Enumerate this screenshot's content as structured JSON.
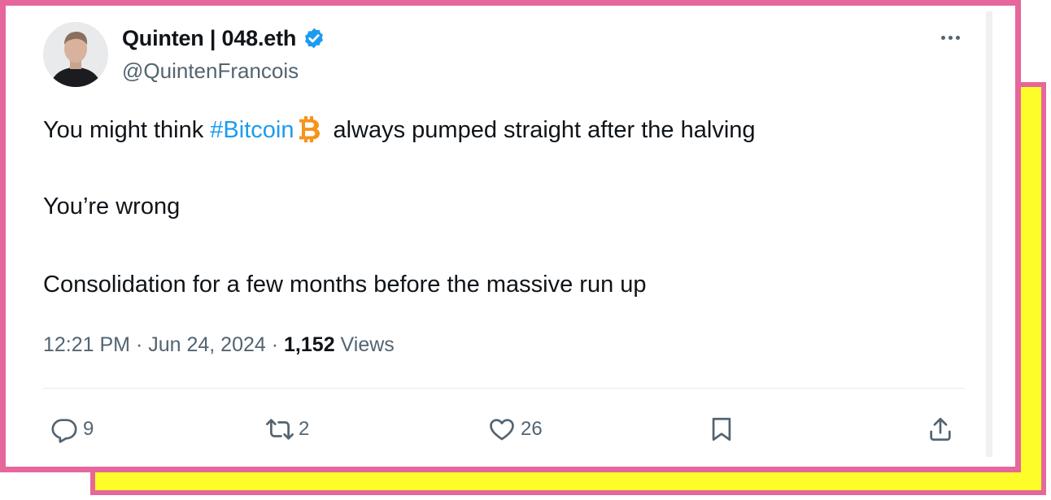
{
  "author": {
    "display_name": "Quinten | 048.eth",
    "handle": "@QuintenFrancois",
    "verified": true
  },
  "tweet": {
    "line1_before": "You might think ",
    "hashtag": "#Bitcoin",
    "line1_emoji": "bitcoin-icon",
    "line1_after": "always pumped straight after the halving",
    "line2": "You’re wrong",
    "line3": "Consolidation for a few months before the massive run up"
  },
  "meta": {
    "time": "12:21 PM",
    "separator": " · ",
    "date": "Jun 24, 2024",
    "views_count": "1,152",
    "views_label": "Views"
  },
  "actions": {
    "reply_count": "9",
    "retweet_count": "2",
    "like_count": "26"
  },
  "colors": {
    "frame": "#e5679b",
    "back_fill": "#fdfd2a",
    "link": "#1d9bf0",
    "bitcoin": "#f7931a",
    "verified": "#1d9bf0"
  }
}
